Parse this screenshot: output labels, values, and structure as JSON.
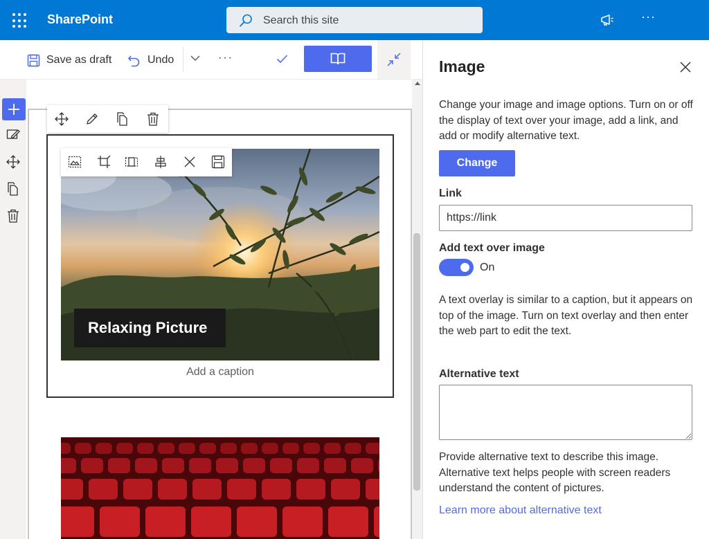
{
  "suite": {
    "brand": "SharePoint",
    "search_placeholder": "Search this site",
    "icons": [
      "waffle-icon",
      "search-icon",
      "megaphone-icon",
      "more-icon"
    ],
    "accent_color": "#0078d4"
  },
  "commandbar": {
    "save_draft": "Save as draft",
    "undo": "Undo",
    "more": "···"
  },
  "webpart": {
    "overlay_text": "Relaxing Picture",
    "caption_placeholder": "Add a caption"
  },
  "pane": {
    "title": "Image",
    "description": "Change your image and image options. Turn on or off the display of text over your image, add a link, and add or modify alternative text.",
    "change_button": "Change",
    "link_label": "Link",
    "link_value": "https://link",
    "overlay_label": "Add text over image",
    "overlay_state": "On",
    "overlay_help": "A text overlay is similar to a caption, but it appears on top of the image. Turn on text overlay and then enter the web part to edit the text.",
    "alt_label": "Alternative text",
    "alt_value": "",
    "alt_help": "Provide alternative text to describe this image. Alternative text helps people with screen readers understand the content of pictures.",
    "learn_more": "Learn more about alternative text",
    "accent_color": "#4f6bed"
  }
}
